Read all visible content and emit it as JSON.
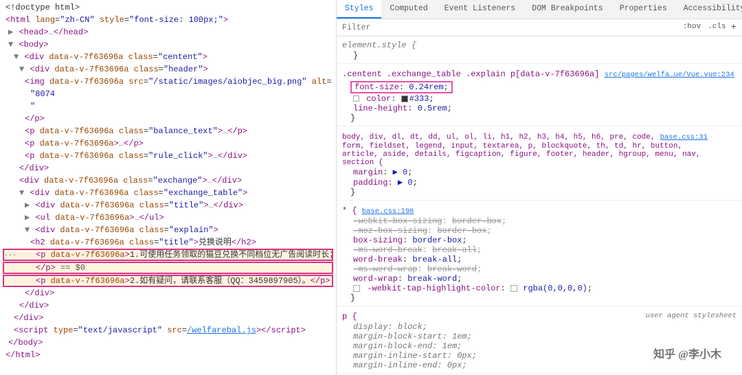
{
  "tabs": {
    "styles": "Styles",
    "computed": "Computed",
    "event_listeners": "Event Listeners",
    "dom_breakpoints": "DOM Breakpoints",
    "properties": "Properties",
    "accessibility": "Accessibility"
  },
  "filter": {
    "placeholder": "Filter",
    "hov_btn": ":hov",
    "cls_btn": ".cls",
    "plus_btn": "+"
  },
  "dom": {
    "lines": [
      {
        "indent": 0,
        "content": "<!doctype html>"
      },
      {
        "indent": 0,
        "content": "<html lang=\"zh-CN\" style=\"font-size: 100px;\">"
      },
      {
        "indent": 1,
        "content": "▶ <head>…</head>"
      },
      {
        "indent": 1,
        "content": "▼ <body>"
      },
      {
        "indent": 2,
        "content": "▼ <div data-v-7f63696a class=\"centent\">"
      },
      {
        "indent": 3,
        "content": "▼ <div data-v-7f63696a class=\"header\">"
      },
      {
        "indent": 4,
        "content": "<p data-v-7f63696a class=\"balance_text\">…</p>"
      },
      {
        "indent": 4,
        "content": "<img data-v-7f63696a src=\"/static/images/aiobjec_big.png\" alt="
      },
      {
        "indent": 5,
        "content": "\"8074"
      },
      {
        "indent": 5,
        "content": "\""
      },
      {
        "indent": 4,
        "content": "</p>"
      },
      {
        "indent": 4,
        "content": "<p data-v-7f63696a class=\"balance_text\">…</p>"
      },
      {
        "indent": 4,
        "content": "<p data-v-7f63696a>…</p>"
      },
      {
        "indent": 4,
        "content": "<p data-v-7f63696a class=\"rule_click\">…</div>"
      },
      {
        "indent": 3,
        "content": "</div>"
      },
      {
        "indent": 3,
        "content": "<div data-v-7f63696a class=\"exchange\">…</div>"
      },
      {
        "indent": 3,
        "content": "▼ <div data-v-7f63696a class=\"exchange_table\">"
      },
      {
        "indent": 4,
        "content": "▶ <div data-v-7f63696a class=\"title\">…</div>"
      },
      {
        "indent": 4,
        "content": "▶ <ul data-v-7f63696a>…</ul>"
      },
      {
        "indent": 4,
        "content": "▼ <div data-v-7f63696a class=\"explain\">"
      },
      {
        "indent": 5,
        "content": "<h2 data-v-7f63696a class=\"title\">兑换说明</h2>"
      },
      {
        "indent": 5,
        "content": "<p data-v-7f63696a>1.可使用任务领取的猫豆兑换不同档位无广告阅读时长；",
        "highlight": true
      },
      {
        "indent": 5,
        "content": "</p> == $0",
        "highlight": true
      },
      {
        "indent": 5,
        "content": "<p data-v-7f63696a>2.如有疑问，请联系客服（QQ：3459897905）。</p>",
        "highlight": true
      },
      {
        "indent": 4,
        "content": "</div>"
      },
      {
        "indent": 3,
        "content": "</div>"
      },
      {
        "indent": 2,
        "content": "</div>"
      },
      {
        "indent": 2,
        "content": "<script type=\"text/javascript\" src=\"/welfarebal.js\"></scr"
      },
      {
        "indent": 1,
        "content": "</body>"
      },
      {
        "indent": 0,
        "content": "</html>"
      }
    ]
  },
  "styles": {
    "element_style": {
      "selector": "element.style {",
      "close": "}"
    },
    "rule1": {
      "selector": ".centent .exchange_table .explain p[data-v-7f63696a]",
      "source": "src/pages/welfa…ue/Vue.vue:234",
      "properties": [
        {
          "name": "font-size",
          "value": "0.24rem",
          "highlighted": true
        },
        {
          "name": "color",
          "value": "#333",
          "has_swatch": true,
          "swatch_color": "#333333"
        },
        {
          "name": "line-height",
          "value": "0.5rem"
        }
      ]
    },
    "rule2": {
      "selector": "body, div, dl, dt, dd, ul, ol, li, h1, h2, h3, h4, h5, h6, pre, code,",
      "selector2": "form, fieldset, legend, input, textarea, p, blockquote, th, td, hr, button,",
      "selector3": "article, aside, details, figcaption, figure, footer, header, hgroup, menu, nav,",
      "selector4": "section {",
      "source": "base.css:31",
      "properties": [
        {
          "name": "margin",
          "value": "▶ 0"
        },
        {
          "name": "padding",
          "value": "▶ 0"
        }
      ]
    },
    "rule3": {
      "selector": "* {",
      "source": "base.css:198",
      "properties": [
        {
          "name": "-webkit-box-sizing",
          "value": "border-box",
          "strikethrough": true
        },
        {
          "name": "-moz-box-sizing",
          "value": "border-box",
          "strikethrough": true
        },
        {
          "name": "box-sizing",
          "value": "border-box"
        },
        {
          "name": "-ms-word-break",
          "value": "break-all",
          "strikethrough": true
        },
        {
          "name": "word-break",
          "value": "break-all"
        },
        {
          "name": "-ms-word-wrap",
          "value": "break-word",
          "strikethrough": true
        },
        {
          "name": "word-wrap",
          "value": "break-word"
        },
        {
          "name": "-webkit-tap-highlight-color",
          "value": "rgba(0,0,0,0)",
          "has_swatch": true,
          "has_checkbox": true
        }
      ]
    },
    "rule4": {
      "selector": "p {",
      "source_label": "user agent stylesheet",
      "properties": [
        {
          "name": "display",
          "value": "block"
        },
        {
          "name": "margin-block-start",
          "value": "1em"
        },
        {
          "name": "margin-block-end",
          "value": "1em"
        },
        {
          "name": "margin-inline-start",
          "value": "0px"
        },
        {
          "name": "margin-inline-end",
          "value": "0px"
        }
      ]
    }
  },
  "watermark": "知乎 @李小木"
}
